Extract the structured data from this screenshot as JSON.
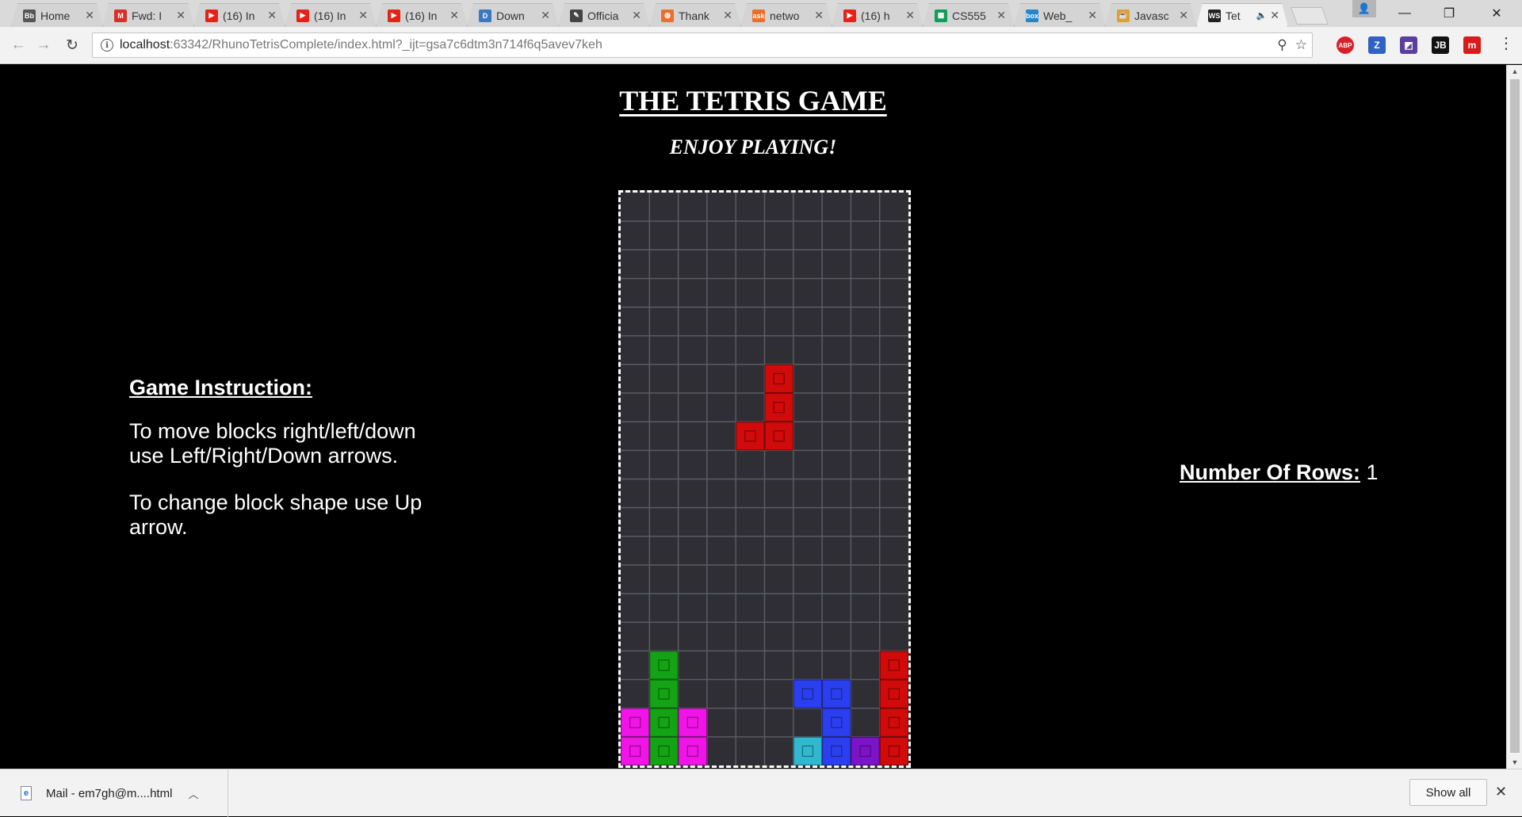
{
  "browser": {
    "tabs": [
      {
        "title": "Home",
        "favicon": "Bb",
        "favicon_color": "#555555",
        "active": false
      },
      {
        "title": "Fwd: I",
        "favicon": "M",
        "favicon_color": "#d93025",
        "active": false
      },
      {
        "title": "(16) In",
        "favicon": "▶",
        "favicon_color": "#e62117",
        "active": false
      },
      {
        "title": "(16) In",
        "favicon": "▶",
        "favicon_color": "#e62117",
        "active": false
      },
      {
        "title": "(16) In",
        "favicon": "▶",
        "favicon_color": "#e62117",
        "active": false
      },
      {
        "title": "Down",
        "favicon": "D",
        "favicon_color": "#3b78c3",
        "active": false
      },
      {
        "title": "Officia",
        "favicon": "✎",
        "favicon_color": "#444444",
        "active": false
      },
      {
        "title": "Thank",
        "favicon": "◍",
        "favicon_color": "#e8702a",
        "active": false
      },
      {
        "title": "netwo",
        "favicon": "ask",
        "favicon_color": "#e8702a",
        "active": false
      },
      {
        "title": "(16) h",
        "favicon": "▶",
        "favicon_color": "#e62117",
        "active": false
      },
      {
        "title": "CS555",
        "favicon": "▦",
        "favicon_color": "#0f9d58",
        "active": false
      },
      {
        "title": "Web_",
        "favicon": "box",
        "favicon_color": "#2486c8",
        "active": false
      },
      {
        "title": "Javasc",
        "favicon": "☕",
        "favicon_color": "#e0a030",
        "active": false
      },
      {
        "title": "Tet",
        "favicon": "WS",
        "favicon_color": "#222222",
        "active": true
      }
    ],
    "url_host": "localhost",
    "url_rest": ":63342/RhunoTetrisComplete/index.html?_ijt=gsa7c6dtm3n714f6q5avev7keh",
    "extensions": [
      {
        "name": "adblock-plus-icon",
        "label": "ABP",
        "color": "#d8202a"
      },
      {
        "name": "zotero-icon",
        "label": "Z",
        "color": "#3062c4"
      },
      {
        "name": "extension-icon",
        "label": "◩",
        "color": "#5b3f9c"
      },
      {
        "name": "jetbrains-icon",
        "label": "JB",
        "color": "#111111"
      },
      {
        "name": "m-icon",
        "label": "m",
        "color": "#d81b1b"
      }
    ]
  },
  "page": {
    "title": "THE TETRIS GAME",
    "subtitle": "ENJOY PLAYING!",
    "instructions": {
      "heading": "Game Instruction:",
      "move": "To move blocks right/left/down use Left/Right/Down arrows.",
      "rotate": "To change block shape use Up arrow."
    },
    "rows_label": "Number Of Rows:",
    "rows_value": "1"
  },
  "board": {
    "cols": 10,
    "rows": 20,
    "colors": {
      "red": "#d10a0a",
      "green": "#14a314",
      "blue": "#2b3ff0",
      "magenta": "#f015e6",
      "cyan": "#2fb8cf",
      "purple": "#7c13c9"
    },
    "blocks": [
      {
        "row": 6,
        "col": 5,
        "color": "red"
      },
      {
        "row": 7,
        "col": 5,
        "color": "red"
      },
      {
        "row": 8,
        "col": 4,
        "color": "red"
      },
      {
        "row": 8,
        "col": 5,
        "color": "red"
      },
      {
        "row": 16,
        "col": 1,
        "color": "green"
      },
      {
        "row": 17,
        "col": 1,
        "color": "green"
      },
      {
        "row": 18,
        "col": 1,
        "color": "green"
      },
      {
        "row": 19,
        "col": 1,
        "color": "green"
      },
      {
        "row": 18,
        "col": 0,
        "color": "magenta"
      },
      {
        "row": 19,
        "col": 0,
        "color": "magenta"
      },
      {
        "row": 18,
        "col": 2,
        "color": "magenta"
      },
      {
        "row": 19,
        "col": 2,
        "color": "magenta"
      },
      {
        "row": 17,
        "col": 6,
        "color": "blue"
      },
      {
        "row": 17,
        "col": 7,
        "color": "blue"
      },
      {
        "row": 18,
        "col": 7,
        "color": "blue"
      },
      {
        "row": 19,
        "col": 7,
        "color": "blue"
      },
      {
        "row": 19,
        "col": 6,
        "color": "cyan"
      },
      {
        "row": 19,
        "col": 8,
        "color": "purple"
      },
      {
        "row": 16,
        "col": 9,
        "color": "red"
      },
      {
        "row": 17,
        "col": 9,
        "color": "red"
      },
      {
        "row": 18,
        "col": 9,
        "color": "red"
      },
      {
        "row": 19,
        "col": 9,
        "color": "red"
      }
    ]
  },
  "download": {
    "filename": "Mail - em7gh@m....html",
    "show_all": "Show all"
  }
}
